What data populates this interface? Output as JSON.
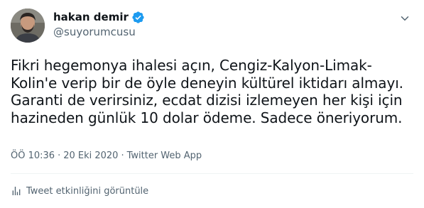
{
  "author": {
    "display_name": "hakan demir",
    "handle": "@suyorumcusu",
    "verified": true
  },
  "tweet": {
    "lines": [
      "Fikri hegemonya ihalesi açın, Cengiz-Kalyon-Limak-",
      "Kolin'e verip bir de öyle deneyin kültürel iktidarı almayı.",
      "Garanti de verirsiniz, ecdat dizisi izlemeyen her kişi için",
      "hazineden günlük 10 dolar ödeme. Sadece öneriyorum."
    ]
  },
  "meta": {
    "time": "ÖÖ 10:36",
    "separator": "·",
    "date": "20 Eki 2020",
    "source": "Twitter Web App"
  },
  "activity": {
    "label": "Tweet etkinliğini görüntüle"
  },
  "colors": {
    "text": "#0f1419",
    "secondary": "#536471",
    "verified": "#1d9bf0",
    "divider": "#eff3f4"
  },
  "icons": {
    "verified": "verified-badge-icon",
    "more": "chevron-down-icon",
    "activity": "bar-chart-icon"
  }
}
